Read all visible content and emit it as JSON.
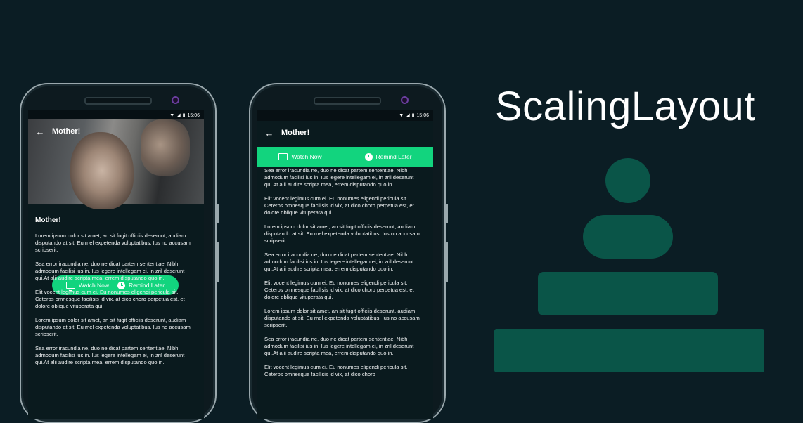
{
  "status_bar": {
    "time": "15:06"
  },
  "phone_expanded": {
    "toolbar_title": "Mother!",
    "watch_now_label": "Watch Now",
    "remind_later_label": "Remind Later",
    "movie_title": "Mother!",
    "paragraphs": [
      "Lorem ipsum dolor sit amet, an sit fugit officiis deserunt, audiam disputando at sit. Eu mel expetenda voluptatibus. Ius no accusam scripserit.",
      " Sea error iracundia ne, duo ne dicat partem sententiae. Nibh admodum facilisi ius in. Ius legere intellegam ei, in zril deserunt qui.At alii audire scripta mea, errem disputando quo in.",
      " Elit vocent legimus cum ei. Eu nonumes eligendi pericula sit. Ceteros omnesque facilisis id vix, at dico choro perpetua est, et dolore oblique vituperata qui.",
      "Lorem ipsum dolor sit amet, an sit fugit officiis deserunt, audiam disputando at sit. Eu mel expetenda voluptatibus. Ius no accusam scripserit.",
      " Sea error iracundia ne, duo ne dicat partem sententiae. Nibh admodum facilisi ius in. Ius legere intellegam ei, in zril deserunt qui.At alii audire scripta mea, errem disputando quo in."
    ]
  },
  "phone_collapsed": {
    "toolbar_title": "Mother!",
    "watch_now_label": "Watch Now",
    "remind_later_label": "Remind Later",
    "paragraphs": [
      " Sea error iracundia ne, duo ne dicat partem sententiae. Nibh admodum facilisi ius in. Ius legere intellegam ei, in zril deserunt qui.At alii audire scripta mea, errem disputando quo in.",
      " Elit vocent legimus cum ei. Eu nonumes eligendi pericula sit. Ceteros omnesque facilisis id vix, at dico choro perpetua est, et dolore oblique vituperata qui.",
      "Lorem ipsum dolor sit amet, an sit fugit officiis deserunt, audiam disputando at sit. Eu mel expetenda voluptatibus. Ius no accusam scripserit.",
      " Sea error iracundia ne, duo ne dicat partem sententiae. Nibh admodum facilisi ius in. Ius legere intellegam ei, in zril deserunt qui.At alii audire scripta mea, errem disputando quo in.",
      " Elit vocent legimus cum ei. Eu nonumes eligendi pericula sit. Ceteros omnesque facilisis id vix, at dico choro perpetua est, et dolore oblique vituperata qui.",
      "Lorem ipsum dolor sit amet, an sit fugit officiis deserunt, audiam disputando at sit. Eu mel expetenda voluptatibus. Ius no accusam scripserit.",
      " Sea error iracundia ne, duo ne dicat partem sententiae. Nibh admodum facilisi ius in. Ius legere intellegam ei, in zril deserunt qui.At alii audire scripta mea, errem disputando quo in.",
      " Elit vocent legimus cum ei. Eu nonumes eligendi pericula sit. Ceteros omnesque facilisis id vix, at dico choro"
    ]
  },
  "brand": {
    "title": "ScalingLayout"
  },
  "colors": {
    "background": "#0b1d24",
    "accent": "#12d47e",
    "shape": "#0a5548"
  },
  "icons": [
    "back-arrow-icon",
    "tv-icon",
    "clock-icon",
    "wifi-icon",
    "signal-icon",
    "battery-icon"
  ]
}
